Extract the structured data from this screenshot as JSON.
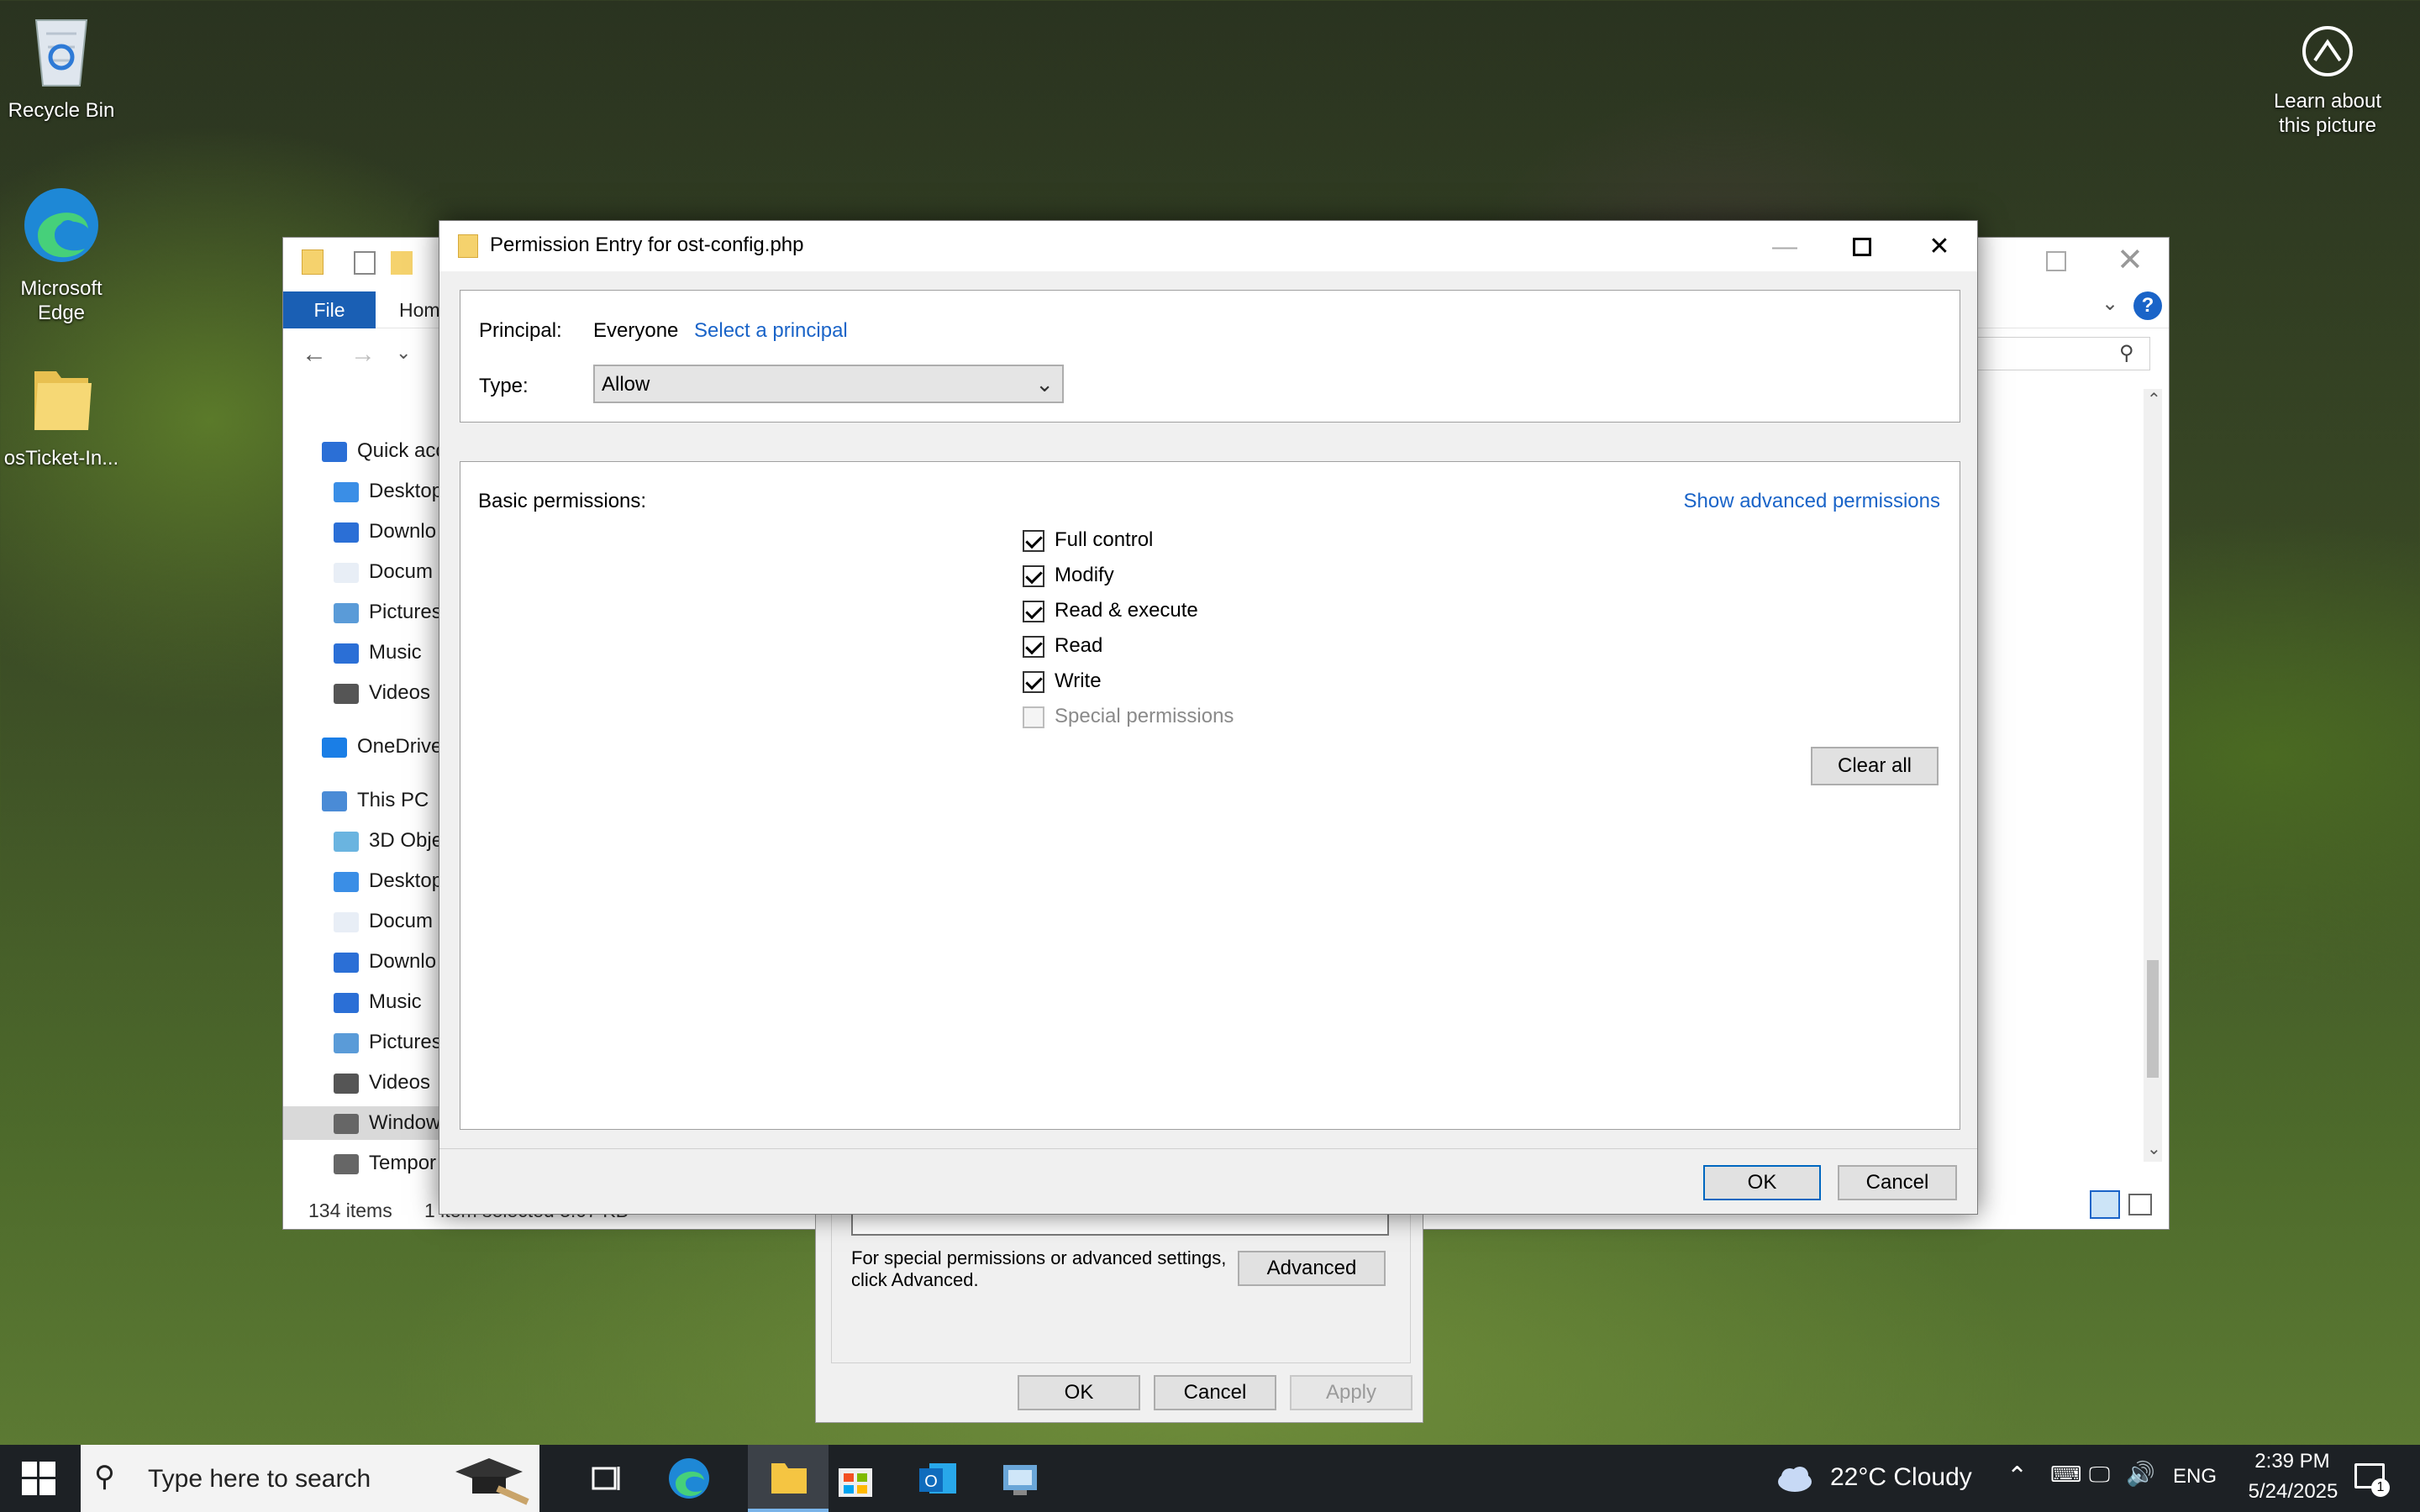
{
  "desktop": {
    "icons": [
      {
        "label": "Recycle Bin"
      },
      {
        "label": "Microsoft Edge"
      },
      {
        "label": "osTicket-In..."
      }
    ],
    "learn_line1": "Learn about",
    "learn_line2": "this picture"
  },
  "explorer": {
    "tabs": {
      "file": "File",
      "home": "Hom"
    },
    "nav": [
      {
        "label": "Quick acc",
        "icon": "star-icon"
      },
      {
        "label": "Desktop",
        "icon": "desktop-icon"
      },
      {
        "label": "Downlo",
        "icon": "download-icon"
      },
      {
        "label": "Docum",
        "icon": "document-icon"
      },
      {
        "label": "Pictures",
        "icon": "pictures-icon"
      },
      {
        "label": "Music",
        "icon": "music-icon"
      },
      {
        "label": "Videos",
        "icon": "videos-icon"
      },
      {
        "label": "OneDrive",
        "icon": "onedrive-icon"
      },
      {
        "label": "This PC",
        "icon": "pc-icon"
      },
      {
        "label": "3D Obje",
        "icon": "3d-objects-icon"
      },
      {
        "label": "Desktop",
        "icon": "desktop-icon"
      },
      {
        "label": "Docum",
        "icon": "document-icon"
      },
      {
        "label": "Downlo",
        "icon": "download-icon"
      },
      {
        "label": "Music",
        "icon": "music-icon"
      },
      {
        "label": "Pictures",
        "icon": "pictures-icon"
      },
      {
        "label": "Videos",
        "icon": "videos-icon"
      },
      {
        "label": "Window",
        "icon": "drive-icon"
      },
      {
        "label": "Tempor",
        "icon": "drive-icon"
      }
    ],
    "status_items": "134 items",
    "status_selected": "1 item selected  3.07 KB"
  },
  "properties": {
    "hint": "For special permissions or advanced settings, click Advanced.",
    "advanced": "Advanced",
    "ok": "OK",
    "cancel": "Cancel",
    "apply": "Apply"
  },
  "dialog": {
    "title": "Permission Entry for ost-config.php",
    "principal_label": "Principal:",
    "principal_value": "Everyone",
    "select_principal": "Select a principal",
    "type_label": "Type:",
    "type_value": "Allow",
    "basic_label": "Basic permissions:",
    "show_advanced": "Show advanced permissions",
    "permissions": [
      {
        "label": "Full control",
        "checked": true,
        "enabled": true
      },
      {
        "label": "Modify",
        "checked": true,
        "enabled": true
      },
      {
        "label": "Read & execute",
        "checked": true,
        "enabled": true
      },
      {
        "label": "Read",
        "checked": true,
        "enabled": true
      },
      {
        "label": "Write",
        "checked": true,
        "enabled": true
      },
      {
        "label": "Special permissions",
        "checked": false,
        "enabled": false
      }
    ],
    "clear_all": "Clear all",
    "ok": "OK",
    "cancel": "Cancel"
  },
  "taskbar": {
    "search_placeholder": "Type here to search",
    "weather": "22°C  Cloudy",
    "lang": "ENG",
    "time": "2:39 PM",
    "date": "5/24/2025",
    "notifications": "1"
  }
}
